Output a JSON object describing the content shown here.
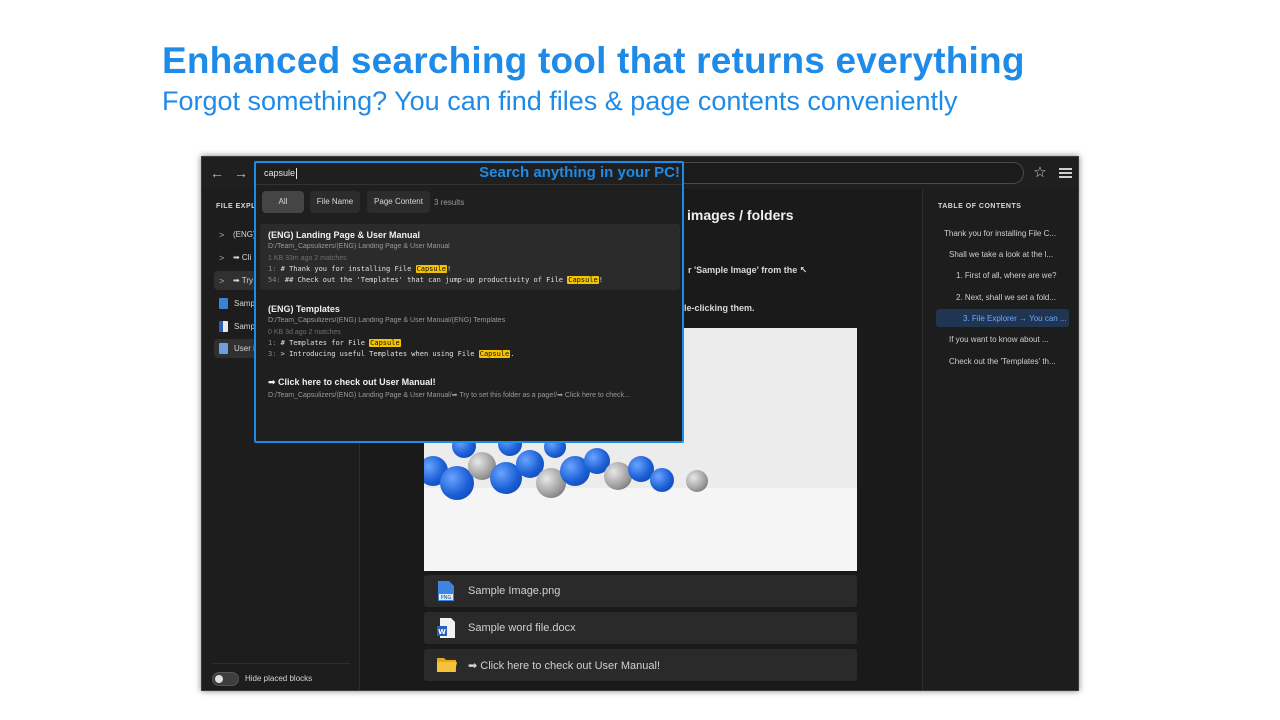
{
  "promo": {
    "title": "Enhanced searching tool that returns everything",
    "subtitle": "Forgot something? You can find files & page contents conveniently"
  },
  "topbar": {
    "back_icon": "arrow-left-icon",
    "forward_icon": "arrow-right-icon",
    "star_icon": "star-icon",
    "menu_icon": "hamburger-menu-icon"
  },
  "sidebar": {
    "title": "FILE EXPLO",
    "items": [
      {
        "label": "(ENG)",
        "chevron": ">"
      },
      {
        "label": "➡ Cli",
        "chevron": ">"
      },
      {
        "label": "➡ Try",
        "chevron": ">"
      },
      {
        "label": "Samp"
      },
      {
        "label": "Samp"
      },
      {
        "label": "User M"
      }
    ],
    "footer_label": "Hide placed blocks"
  },
  "search": {
    "query": "capsule",
    "callout": "Search anything in your PC!",
    "filters": [
      "All",
      "File Name",
      "Page Content"
    ],
    "result_count": "3 results",
    "results": [
      {
        "title": "(ENG) Landing Page & User Manual",
        "path": "D:/Team_Capsulizers/(ENG) Landing Page & User Manual",
        "meta": "1 KB   33m ago   2 matches",
        "lines": [
          {
            "num": "1:",
            "pre": " # Thank you for installing File ",
            "match": "Capsule",
            "post": "!"
          },
          {
            "num": "54:",
            "pre": " ## Check out the 'Templates' that can jump-up productivity of File ",
            "match": "Capsule",
            "post": "!"
          }
        ]
      },
      {
        "title": "(ENG) Templates",
        "path": "D:/Team_Capsulizers/(ENG) Landing Page & User Manual/(ENG) Templates",
        "meta": "0 KB   3d ago   2 matches",
        "lines": [
          {
            "num": "1:",
            "pre": " # Templates for File ",
            "match": "Capsule",
            "post": ""
          },
          {
            "num": "3:",
            "pre": " > Introducing useful Templates when using File ",
            "match": "Capsule",
            "post": "."
          }
        ]
      },
      {
        "title": "➡ Click here to check out User Manual!",
        "path": "D:/Team_Capsulizers/(ENG) Landing Page & User Manual/➡ Try to set this folder as a page!/➡ Click here to check..."
      }
    ]
  },
  "main": {
    "heading": "images / folders",
    "text1": "r 'Sample Image' from the ↖",
    "text2": "le-clicking them.",
    "files": [
      {
        "label": "Sample Image.png",
        "icon": "png-file-icon",
        "badge": "PNG"
      },
      {
        "label": "Sample word file.docx",
        "icon": "word-file-icon",
        "badge": "W"
      },
      {
        "label": "➡ Click here to check out User Manual!",
        "icon": "folder-icon"
      }
    ]
  },
  "toc": {
    "title": "TABLE OF CONTENTS",
    "items": [
      "Thank you for installing File C...",
      "Shall we take a look at the l...",
      "1. First of all, where are we?",
      "2. Next, shall we set a fold...",
      "3. File Explorer → You can ...",
      "If you want to know about ...",
      "Check out the 'Templates' th..."
    ],
    "active_index": 4
  },
  "colors": {
    "accent": "#1f8be8",
    "highlight": "#f5c400",
    "background": "#1c1c1c",
    "toc_active": "#6aa8ff"
  }
}
